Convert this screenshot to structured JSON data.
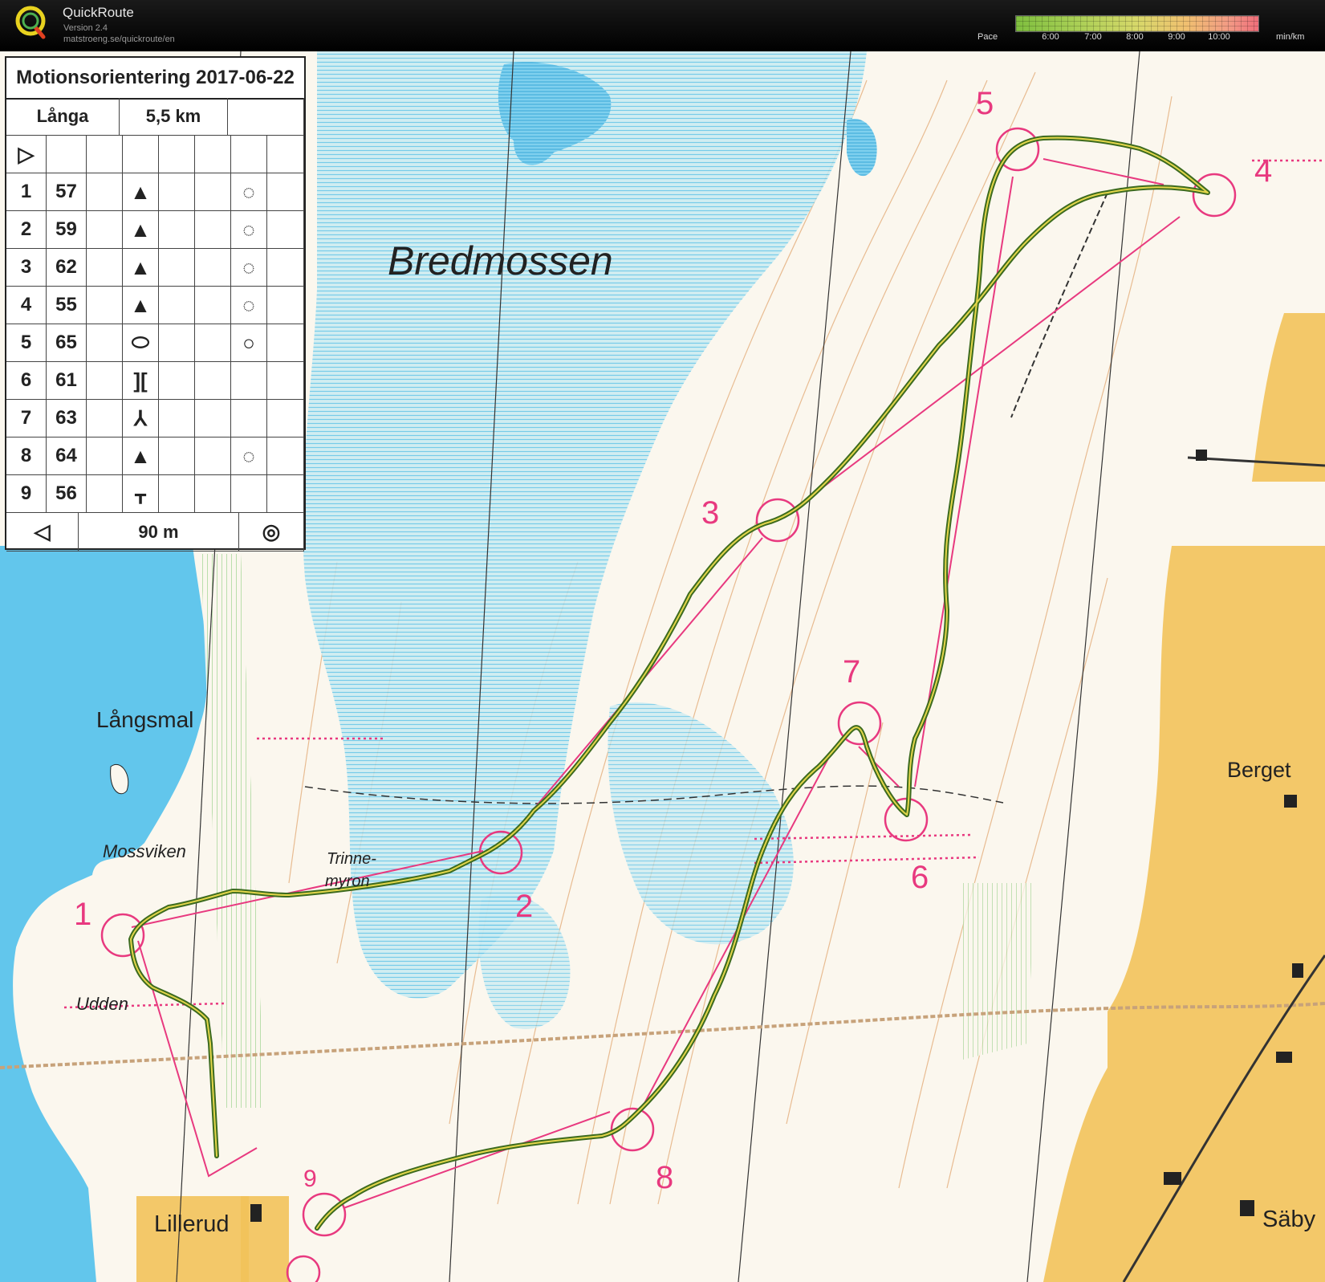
{
  "app": {
    "title": "QuickRoute",
    "version": "Version 2.4",
    "url": "matstroeng.se/quickroute/en",
    "pace_label": "Pace",
    "pace_ticks": [
      "6:00",
      "7:00",
      "8:00",
      "9:00",
      "10:00"
    ],
    "pace_unit": "min/km"
  },
  "control_card": {
    "title": "Motionsorientering 2017-06-22",
    "course": "Långa",
    "length": "5,5 km",
    "controls": [
      {
        "no": "1",
        "code": "57",
        "symbol": "knoll-icon",
        "detail": "depression-icon"
      },
      {
        "no": "2",
        "code": "59",
        "symbol": "knoll-icon",
        "detail": "depression-icon"
      },
      {
        "no": "3",
        "code": "62",
        "symbol": "knoll-icon",
        "detail": "depression-icon"
      },
      {
        "no": "4",
        "code": "55",
        "symbol": "knoll-icon",
        "detail": "depression-icon"
      },
      {
        "no": "5",
        "code": "65",
        "symbol": "oval-icon",
        "detail": "circle-icon"
      },
      {
        "no": "6",
        "code": "61",
        "symbol": "bracket-icon",
        "detail": ""
      },
      {
        "no": "7",
        "code": "63",
        "symbol": "fork-icon",
        "detail": ""
      },
      {
        "no": "8",
        "code": "64",
        "symbol": "knoll-icon",
        "detail": "depression-icon"
      },
      {
        "no": "9",
        "code": "56",
        "symbol": "fence-icon",
        "detail": ""
      }
    ],
    "finish_distance": "90 m"
  },
  "map": {
    "place_names": {
      "bredmossen": "Bredmossen",
      "langsmal": "Långsmal",
      "mossviken": "Mossviken",
      "trinne": "Trinne-",
      "myron": "myron",
      "udden": "Udden",
      "berget": "Berget",
      "lillerud": "Lillerud",
      "saby": "Säby"
    },
    "control_labels": [
      "1",
      "2",
      "3",
      "4",
      "5",
      "6",
      "7",
      "8",
      "9"
    ],
    "colors": {
      "course": "#e8397f",
      "water": "#5fc3e8",
      "marsh": "#bfe6ef",
      "open": "#f2c25a",
      "forest": "#fbf7ee",
      "route_slow": "#2c6b2c",
      "route_fast": "#e8d84a"
    }
  }
}
